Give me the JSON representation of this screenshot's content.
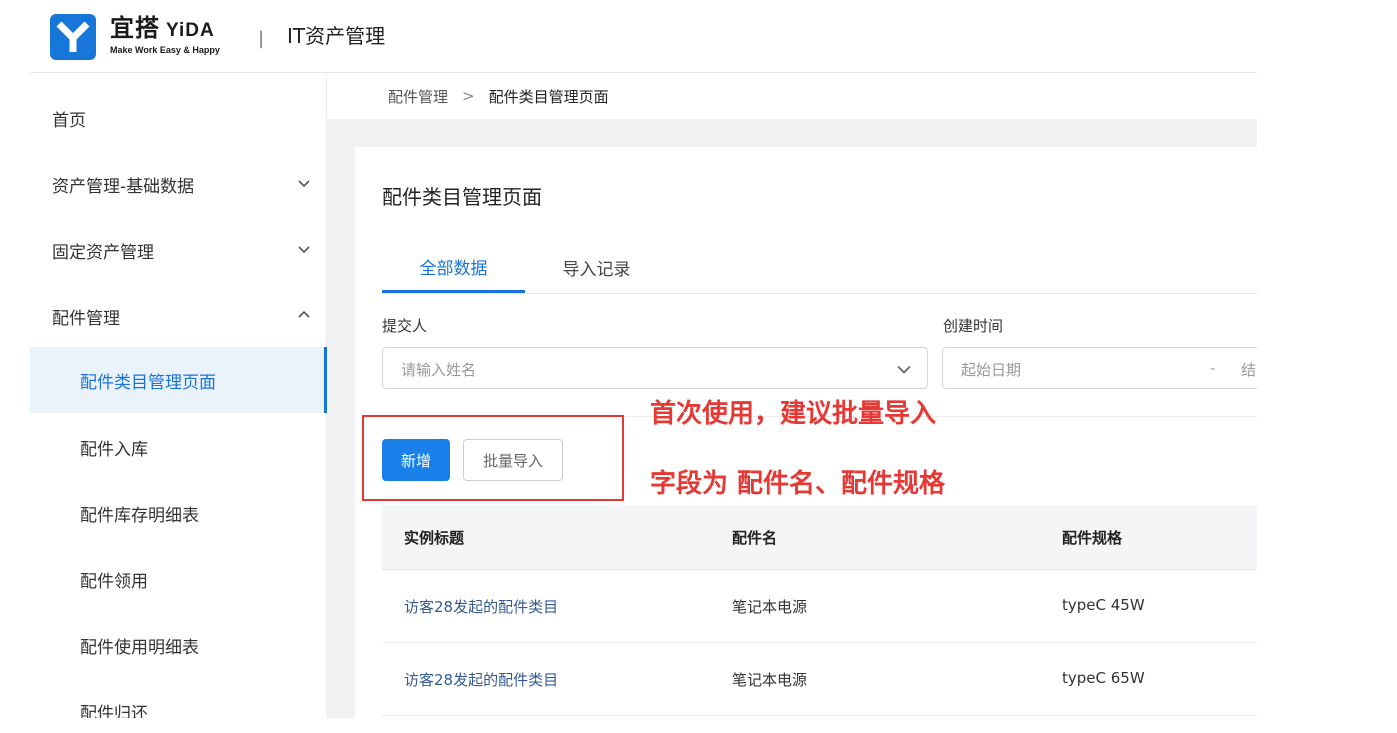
{
  "brand": {
    "name_cn": "宜搭",
    "name_latin": "YiDA",
    "slogan": "Make Work Easy & Happy",
    "separator": "|",
    "app_title": "IT资产管理",
    "logo_color": "#1677d9"
  },
  "sidebar": {
    "items": [
      {
        "label": "首页",
        "level": 1,
        "chevron": null,
        "active": false
      },
      {
        "label": "资产管理-基础数据",
        "level": 1,
        "chevron": "chevron-down-icon",
        "active": false
      },
      {
        "label": "固定资产管理",
        "level": 1,
        "chevron": "chevron-down-icon",
        "active": false
      },
      {
        "label": "配件管理",
        "level": 1,
        "chevron": "chevron-up-icon",
        "active": false
      },
      {
        "label": "配件类目管理页面",
        "level": 2,
        "chevron": null,
        "active": true
      },
      {
        "label": "配件入库",
        "level": 2,
        "chevron": null,
        "active": false
      },
      {
        "label": "配件库存明细表",
        "level": 2,
        "chevron": null,
        "active": false
      },
      {
        "label": "配件领用",
        "level": 2,
        "chevron": null,
        "active": false
      },
      {
        "label": "配件使用明细表",
        "level": 2,
        "chevron": null,
        "active": false
      },
      {
        "label": "配件归还",
        "level": 2,
        "chevron": null,
        "active": false
      }
    ]
  },
  "breadcrumb": {
    "items": [
      "配件管理",
      "配件类目管理页面"
    ],
    "separator": ">"
  },
  "page": {
    "title": "配件类目管理页面",
    "tabs": [
      {
        "label": "全部数据",
        "active": true
      },
      {
        "label": "导入记录",
        "active": false
      }
    ]
  },
  "filters": {
    "submitter": {
      "label": "提交人",
      "placeholder": "请输入姓名"
    },
    "created_time": {
      "label": "创建时间",
      "start_placeholder": "起始日期",
      "range_separator": "-",
      "end_placeholder": "结"
    }
  },
  "actions": {
    "new_label": "新增",
    "import_label": "批量导入"
  },
  "table": {
    "columns": [
      "实例标题",
      "配件名",
      "配件规格"
    ],
    "rows": [
      [
        "访客28发起的配件类目",
        "笔记本电源",
        "typeC 45W"
      ],
      [
        "访客28发起的配件类目",
        "笔记本电源",
        "typeC 65W"
      ]
    ]
  },
  "annotation": {
    "line1": "首次使用，建议批量导入",
    "line2": "字段为 配件名、配件规格",
    "color": "#e53935"
  },
  "colors": {
    "accent": "#1a73d8",
    "primary_button": "#1880e8"
  }
}
